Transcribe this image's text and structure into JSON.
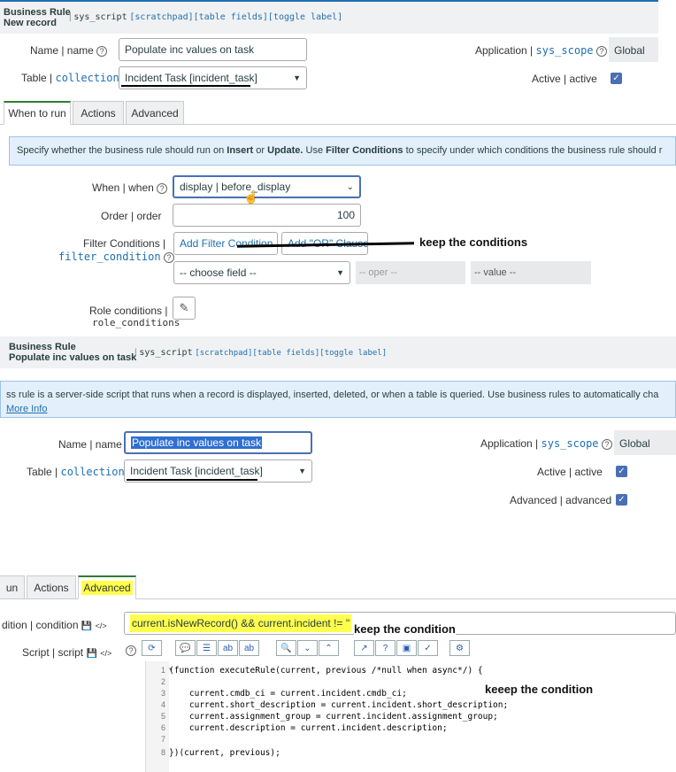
{
  "top_form": {
    "header_title": "Business Rule",
    "header_subtitle": "New record",
    "header_table": "sys_script",
    "header_links": "[scratchpad][table fields][toggle label]",
    "name_label": "Name | name",
    "name_value": "Populate inc values on task",
    "table_label": "Table | ",
    "table_label_field": "collection",
    "table_value": "Incident Task [incident_task]",
    "application_label": "Application | ",
    "application_label_field": "sys_scope",
    "application_value": "Global",
    "active_label": "Active | active",
    "tabs": [
      "When to run",
      "Actions",
      "Advanced"
    ],
    "info_parts": [
      "Specify whether the business rule should run on ",
      "Insert",
      " or ",
      "Update.",
      " Use ",
      "Filter Conditions",
      " to specify under which conditions the business rule should r"
    ],
    "when_label": "When | when",
    "when_value": "display | before_display",
    "order_label": "Order | order",
    "order_value": "100",
    "filter_label": "Filter Conditions |",
    "filter_label_field": "filter_condition",
    "add_filter_button": "Add Filter Condition",
    "add_or_button": "Add \"OR\" Clause",
    "choose_field": "-- choose field --",
    "oper_placeholder": "-- oper --",
    "value_placeholder": "-- value --",
    "role_label": "Role conditions |",
    "role_label_field": "role_conditions",
    "annotation": "keep the conditions"
  },
  "second_form": {
    "header_title": "Business Rule",
    "header_subtitle": "Populate inc values on task",
    "header_table": "sys_script",
    "header_links": "[scratchpad][table fields][toggle label]",
    "info_text": "ss rule is a server-side script that runs when a record is displayed, inserted, deleted, or when a table is queried. Use business rules to automatically cha",
    "more_info": "More Info",
    "name_label": "Name | name",
    "name_value": "Populate inc values on task",
    "table_label": "Table | ",
    "table_label_field": "collection",
    "table_value": "Incident Task [incident_task]",
    "application_label": "Application | ",
    "application_label_field": "sys_scope",
    "application_value": "Global",
    "active_label": "Active | active",
    "advanced_label": "Advanced | advanced"
  },
  "advanced_section": {
    "tabs": [
      "un",
      "Actions",
      "Advanced"
    ],
    "condition_label": "dition | condition",
    "condition_value": "current.isNewRecord() && current.incident != ''",
    "condition_annotation": "keep the condition",
    "script_label": "Script | script",
    "script_annotation": "keeep the condition",
    "code_lines": [
      {
        "num": "1",
        "text": "(function executeRule(current, previous /*null when async*/) {"
      },
      {
        "num": "2",
        "text": ""
      },
      {
        "num": "3",
        "text": "    current.cmdb_ci = current.incident.cmdb_ci;"
      },
      {
        "num": "4",
        "text": "    current.short_description = current.incident.short_description;"
      },
      {
        "num": "5",
        "text": "    current.assignment_group = current.incident.assignment_group;"
      },
      {
        "num": "6",
        "text": "    current.description = current.incident.description;"
      },
      {
        "num": "7",
        "text": ""
      },
      {
        "num": "8",
        "text": "})(current, previous);"
      }
    ]
  },
  "colors": {
    "accent_blue": "#1f6fb2",
    "info_bg": "#e3f0fb",
    "highlight_yellow": "#ffff4d",
    "tab_green": "#2e7d32"
  }
}
